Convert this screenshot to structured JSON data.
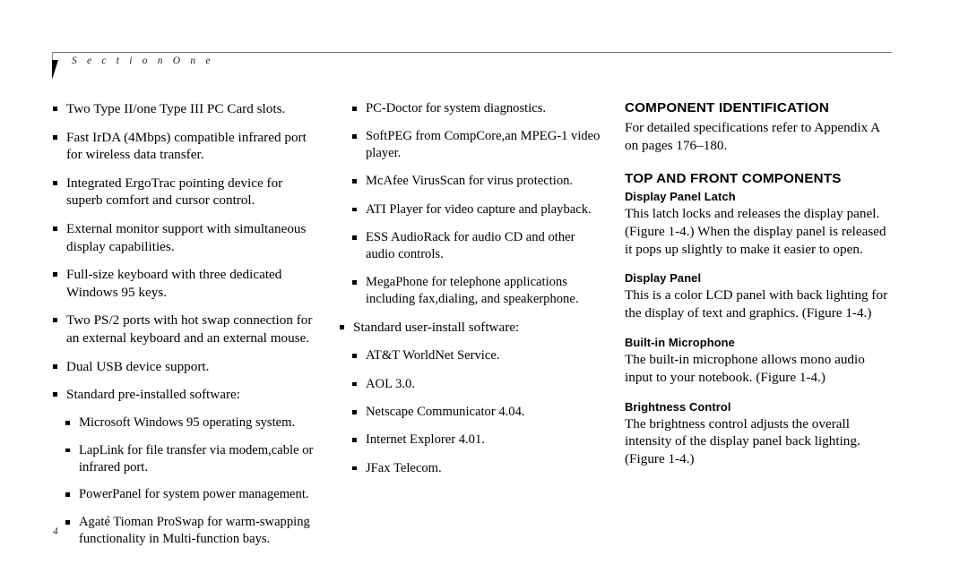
{
  "header": {
    "title": "S e c t i o n    O n e"
  },
  "folio": {
    "page_number": "4"
  },
  "column_1": {
    "items": [
      {
        "level": "top",
        "text": "Two Type II/one Type III PC Card slots."
      },
      {
        "level": "top",
        "text": "Fast IrDA (4Mbps) compatible infrared port for wireless data transfer."
      },
      {
        "level": "top",
        "text": "Integrated ErgoTrac pointing device for superb comfort and cursor control."
      },
      {
        "level": "top",
        "text": "External monitor support with simultaneous display capabilities."
      },
      {
        "level": "top",
        "text": "Full-size keyboard with three dedicated Windows 95 keys."
      },
      {
        "level": "top",
        "text": "Two PS/2 ports with hot swap connection for an external keyboard and an external mouse."
      },
      {
        "level": "top",
        "text": "Dual USB device support."
      },
      {
        "level": "top",
        "text": "Standard pre-installed software:"
      },
      {
        "level": "sub",
        "text": "Microsoft Windows 95 operating system."
      },
      {
        "level": "sub",
        "text": "LapLink for file transfer via modem,cable or infrared port."
      },
      {
        "level": "sub",
        "text": "PowerPanel for system power management."
      },
      {
        "level": "sub",
        "text": "Agaté Tioman ProSwap for warm-swapping functionality in Multi-function bays."
      }
    ]
  },
  "column_2": {
    "items": [
      {
        "level": "sub",
        "text": "PC-Doctor for system diagnostics."
      },
      {
        "level": "sub",
        "text": "SoftPEG from CompCore,an  MPEG-1 video player."
      },
      {
        "level": "sub",
        "text": "McAfee VirusScan for virus protection."
      },
      {
        "level": "sub",
        "text": "ATI Player for video capture and playback."
      },
      {
        "level": "sub",
        "text": "ESS AudioRack for audio CD and other audio controls."
      },
      {
        "level": "sub",
        "text": "MegaPhone for telephone applications including  fax,dialing, and speakerphone."
      },
      {
        "level": "top",
        "text": "Standard user-install software:"
      },
      {
        "level": "sub",
        "text": "AT&T WorldNet Service."
      },
      {
        "level": "sub",
        "text": "AOL 3.0."
      },
      {
        "level": "sub",
        "text": "Netscape Communicator 4.04."
      },
      {
        "level": "sub",
        "text": "Internet Explorer 4.01."
      },
      {
        "level": "sub",
        "text": "JFax Telecom."
      }
    ]
  },
  "column_3": {
    "section_1": {
      "heading": "COMPONENT IDENTIFICATION",
      "body": "For detailed specifications refer to Appendix A on pages 176–180."
    },
    "section_2": {
      "heading": "TOP AND FRONT COMPONENTS",
      "entries": [
        {
          "title": "Display Panel Latch",
          "body": "This latch locks and releases the display panel. (Figure 1-4.) When the display panel is released it pops up slightly to make it easier to open."
        },
        {
          "title": "Display Panel",
          "body": "This is a color LCD panel with back lighting for the display of text and graphics. (Figure 1-4.)"
        },
        {
          "title": "Built-in Microphone",
          "body": "The built-in microphone allows mono audio input to your notebook. (Figure 1-4.)"
        },
        {
          "title": "Brightness Control",
          "body": "The brightness control adjusts the overall intensity of the display panel back lighting. (Figure 1-4.)"
        }
      ]
    }
  }
}
